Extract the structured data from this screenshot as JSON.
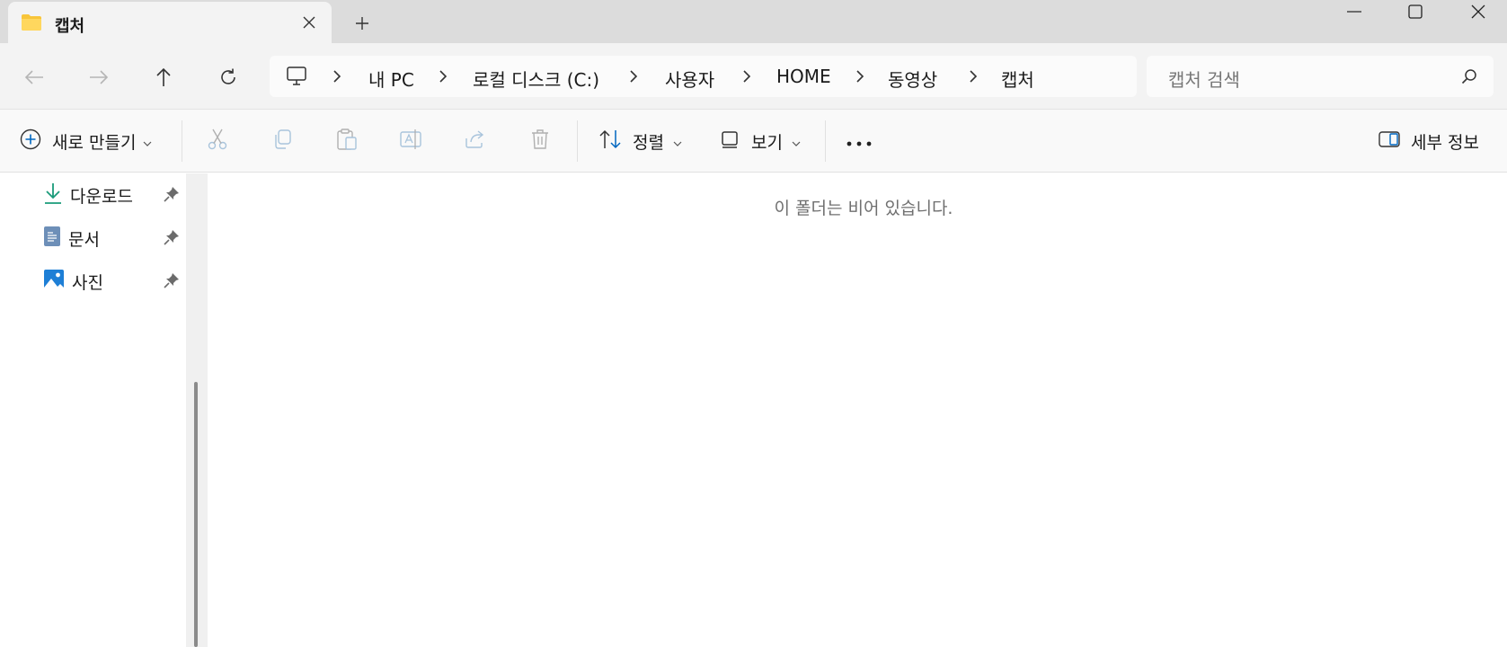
{
  "window": {
    "tab_title": "캡처",
    "icons": {
      "folder": "folder-icon",
      "close": "close-icon",
      "new_tab": "plus-icon",
      "minimize": "minimize-icon",
      "maximize": "maximize-icon",
      "close_window": "close-icon"
    }
  },
  "address": {
    "crumbs": [
      "내 PC",
      "로컬 디스크 (C:)",
      "사용자",
      "HOME",
      "동영상",
      "캡처"
    ]
  },
  "search": {
    "placeholder": "캡처 검색"
  },
  "command_bar": {
    "new_label": "새로 만들기",
    "sort_label": "정렬",
    "view_label": "보기",
    "details_label": "세부 정보"
  },
  "nav_pane": {
    "items": [
      {
        "label": "다운로드",
        "icon": "download-icon"
      },
      {
        "label": "문서",
        "icon": "document-icon"
      },
      {
        "label": "사진",
        "icon": "pictures-icon"
      }
    ]
  },
  "content": {
    "empty_message": "이 폴더는 비어 있습니다."
  },
  "colors": {
    "accent": "#0067c0",
    "folder": "#f8c53a",
    "download": "#1a9b7a"
  }
}
